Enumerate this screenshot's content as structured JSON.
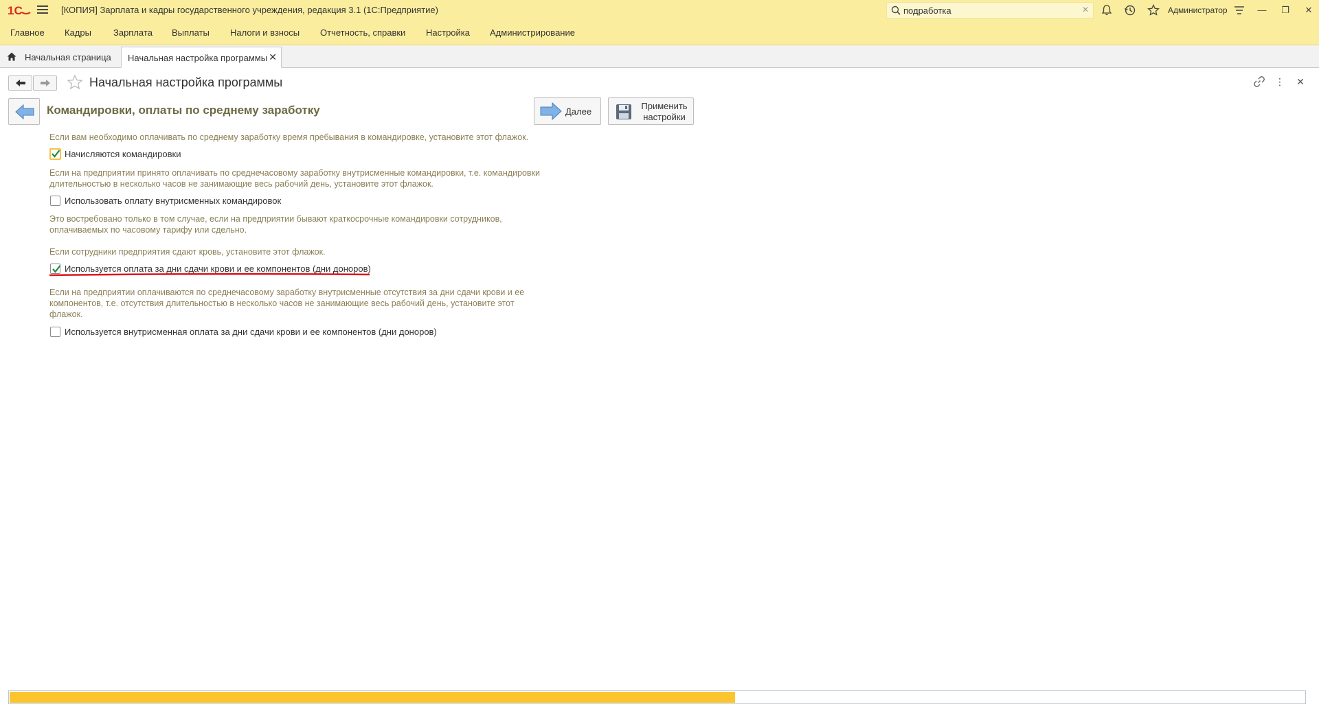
{
  "app": {
    "title": "[КОПИЯ] Зарплата и кадры государственного учреждения, редакция 3.1  (1С:Предприятие)",
    "search_value": "подработка",
    "user": "Администратор"
  },
  "menu": {
    "items": [
      "Главное",
      "Кадры",
      "Зарплата",
      "Выплаты",
      "Налоги и взносы",
      "Отчетность, справки",
      "Настройка",
      "Администрирование"
    ]
  },
  "tabs": {
    "home": "Начальная страница",
    "active": "Начальная настройка программы"
  },
  "form": {
    "title": "Начальная настройка программы",
    "step_title": "Командировки, оплаты по среднему заработку",
    "next_label": "Далее",
    "apply_label": "Применить настройки"
  },
  "content": {
    "hint1": "Если вам необходимо оплачивать по среднему заработку время пребывания в командировке, установите этот флажок.",
    "cb1": {
      "label": "Начисляются командировки",
      "checked": true
    },
    "hint2a": "Если на предприятии принято оплачивать по среднечасовому заработку внутрисменные командировки, т.е. командировки",
    "hint2b": "длительностью в несколько часов не занимающие весь рабочий день, установите этот флажок.",
    "cb2": {
      "label": "Использовать оплату внутрисменных командировок",
      "checked": false
    },
    "hint3a": "Это востребовано только в том случае, если на предприятии бывают краткосрочные командировки сотрудников,",
    "hint3b": "оплачиваемых по часовому тарифу или сдельно.",
    "hint4": "Если сотрудники предприятия сдают кровь, установите этот флажок.",
    "cb3": {
      "label": "Используется оплата за дни сдачи крови и ее компонентов (дни доноров)",
      "checked": true
    },
    "hint5a": "Если на предприятии оплачиваются по среднечасовому заработку внутрисменные отсутствия за дни сдачи крови и ее",
    "hint5b": "компонентов, т.е. отсутствия длительностью в несколько часов не занимающие весь рабочий день, установите этот",
    "hint5c": "флажок.",
    "cb4": {
      "label": "Используется внутрисменная оплата за дни сдачи крови и ее компонентов (дни доноров)",
      "checked": false
    }
  },
  "progress": {
    "value": 0.56
  },
  "colors": {
    "accent": "#fbed9e",
    "progress": "#fbc530",
    "hint": "#8b7f55",
    "highlight": "#e0141e"
  }
}
